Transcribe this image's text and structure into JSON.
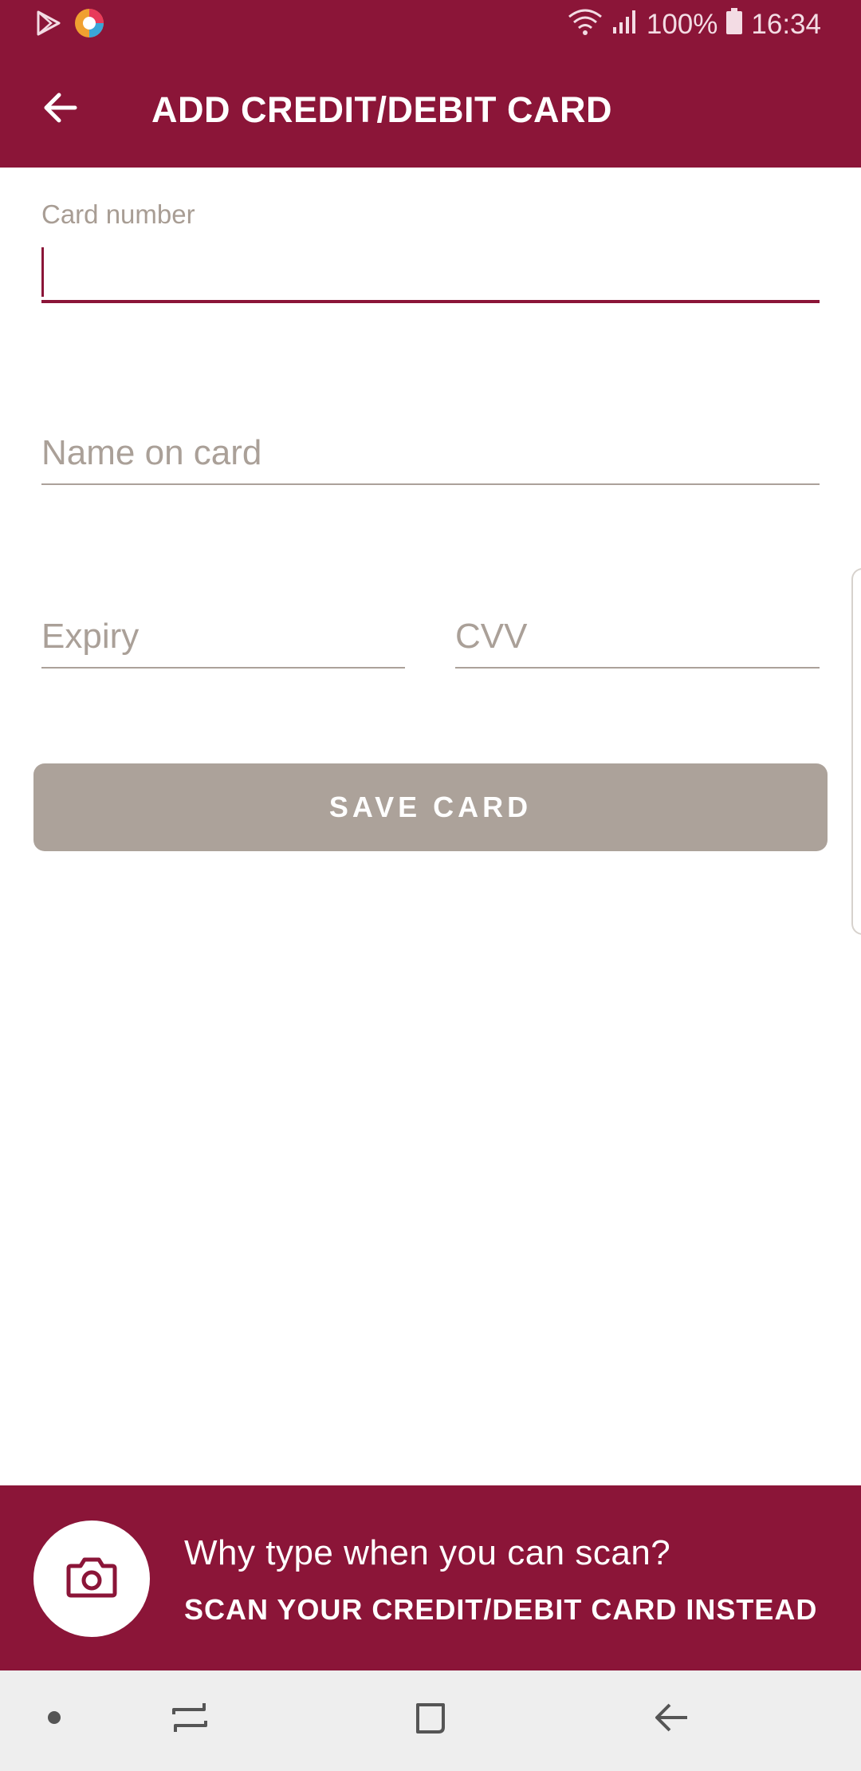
{
  "status_bar": {
    "battery": "100%",
    "time": "16:34",
    "icons": [
      "play-store-icon",
      "app-notification-icon",
      "wifi-icon",
      "signal-icon",
      "battery-icon"
    ]
  },
  "app_bar": {
    "title": "ADD CREDIT/DEBIT CARD",
    "back_icon": "arrow-left-icon"
  },
  "form": {
    "card_number": {
      "label": "Card number",
      "value": ""
    },
    "name_on_card": {
      "placeholder": "Name on card",
      "value": ""
    },
    "expiry": {
      "placeholder": "Expiry",
      "value": ""
    },
    "cvv": {
      "placeholder": "CVV",
      "value": ""
    },
    "save_label": "SAVE CARD"
  },
  "scan_banner": {
    "question": "Why type when you can scan?",
    "cta": "SCAN YOUR CREDIT/DEBIT CARD INSTEAD",
    "icon": "camera-icon"
  },
  "nav_bar": {
    "items": [
      "dot-icon",
      "recent-apps-icon",
      "home-icon",
      "back-icon"
    ]
  },
  "colors": {
    "brand": "#8b1538",
    "button_disabled": "#aca29a",
    "placeholder": "#aaa098",
    "nav_bg": "#eeeeee"
  }
}
